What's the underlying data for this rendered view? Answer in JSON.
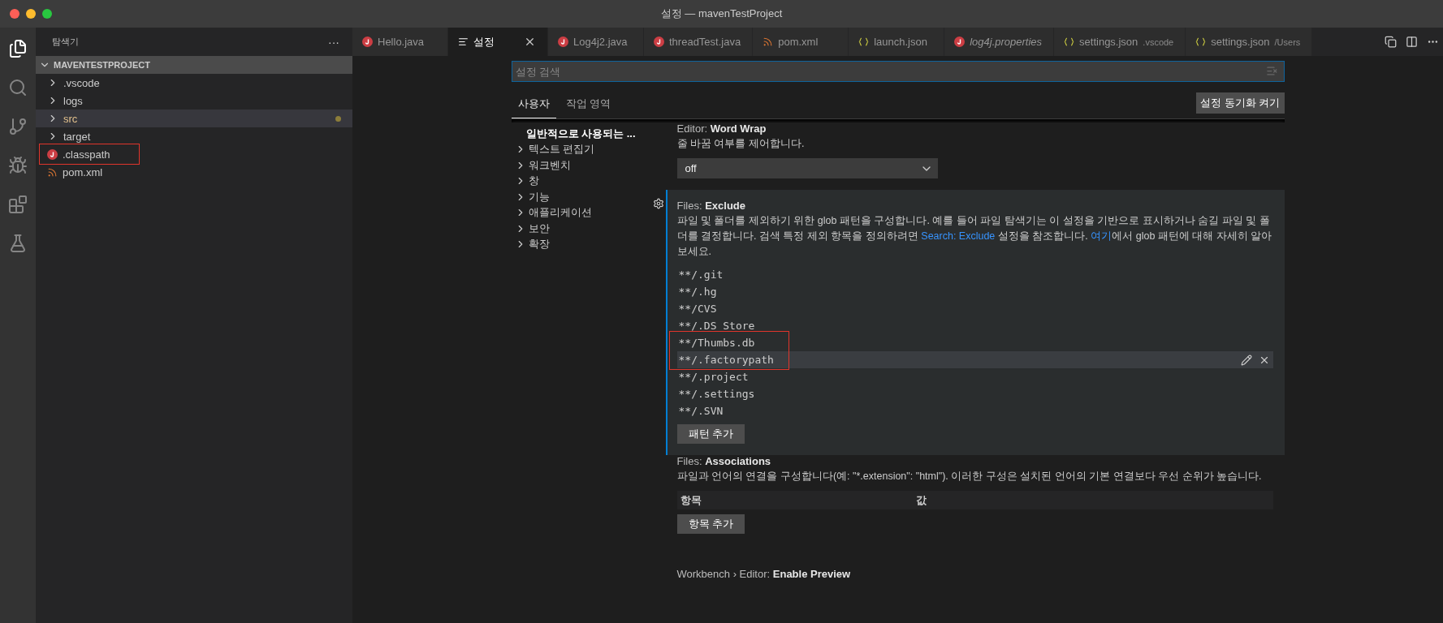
{
  "window": {
    "title": "설정 — mavenTestProject"
  },
  "sidebar": {
    "title": "탐색기",
    "more": "···",
    "section": "MAVENTESTPROJECT",
    "items": [
      {
        "label": ".vscode",
        "kind": "folder",
        "selected": false,
        "modified": false,
        "marked": false
      },
      {
        "label": "logs",
        "kind": "folder",
        "selected": false,
        "modified": false,
        "marked": false
      },
      {
        "label": "src",
        "kind": "folder",
        "selected": true,
        "modified": true,
        "marked": false
      },
      {
        "label": "target",
        "kind": "folder",
        "selected": false,
        "modified": false,
        "marked": false
      },
      {
        "label": ".classpath",
        "kind": "java",
        "selected": false,
        "modified": false,
        "marked": true
      },
      {
        "label": "pom.xml",
        "kind": "xml",
        "selected": false,
        "modified": false,
        "marked": false
      }
    ]
  },
  "tabs": [
    {
      "label": "Hello.java",
      "kind": "java",
      "selected": false,
      "preview": false
    },
    {
      "label": "설정",
      "kind": "settings",
      "selected": true,
      "preview": false
    },
    {
      "label": "Log4j2.java",
      "kind": "java",
      "selected": false,
      "preview": false
    },
    {
      "label": "threadTest.java",
      "kind": "java",
      "selected": false,
      "preview": false
    },
    {
      "label": "pom.xml",
      "kind": "xml",
      "selected": false,
      "preview": false
    },
    {
      "label": "launch.json",
      "kind": "json",
      "selected": false,
      "preview": false
    },
    {
      "label": "log4j.properties",
      "kind": "java",
      "selected": false,
      "preview": true
    },
    {
      "label": "settings.json",
      "description": ".vscode",
      "kind": "json",
      "selected": false,
      "preview": false
    },
    {
      "label": "settings.json",
      "description": "/Users",
      "kind": "json",
      "selected": false,
      "preview": false
    }
  ],
  "settings": {
    "search": {
      "placeholder": "설정 검색"
    },
    "scopes": [
      {
        "label": "사용자",
        "selected": true
      },
      {
        "label": "작업 영역",
        "selected": false
      }
    ],
    "sync_button": "설정 동기화 켜기",
    "toc": [
      {
        "label": "일반적으로 사용되는 ...",
        "selected": true,
        "expandable": false
      },
      {
        "label": "텍스트 편집기",
        "selected": false,
        "expandable": true
      },
      {
        "label": "워크벤치",
        "selected": false,
        "expandable": true
      },
      {
        "label": "창",
        "selected": false,
        "expandable": true
      },
      {
        "label": "기능",
        "selected": false,
        "expandable": true
      },
      {
        "label": "애플리케이션",
        "selected": false,
        "expandable": true
      },
      {
        "label": "보안",
        "selected": false,
        "expandable": true
      },
      {
        "label": "확장",
        "selected": false,
        "expandable": true
      }
    ],
    "items": [
      {
        "kind": "select",
        "category": "Editor: ",
        "title": "Word Wrap",
        "focused": false,
        "description": [
          {
            "text": "줄 바꿈 여부를 제어합니다."
          }
        ],
        "value": "off"
      },
      {
        "kind": "list",
        "category": "Files: ",
        "title": "Exclude",
        "focused": true,
        "description": [
          {
            "text": "파일 및 폴더를 제외하기 위한 glob 패턴을 구성합니다. 예를 들어 파일 탐색기는 이 설정을 기반으로 표시하거나 숨길 파일 및 폴더를 결정합니다. 검색 특정 제외 항목을 정의하려면 "
          },
          {
            "link": "Search: Exclude"
          },
          {
            "text": " 설정을 참조합니다. "
          },
          {
            "link": "여기"
          },
          {
            "text": "에서 glob 패턴에 대해 자세히 알아보세요."
          }
        ],
        "patterns": [
          {
            "text": "**/.git",
            "hovered": false,
            "marked": false
          },
          {
            "text": "**/.hg",
            "hovered": false,
            "marked": false
          },
          {
            "text": "**/CVS",
            "hovered": false,
            "marked": false
          },
          {
            "text": "**/.DS_Store",
            "hovered": false,
            "marked": false
          },
          {
            "text": "**/Thumbs.db",
            "hovered": false,
            "marked": true
          },
          {
            "text": "**/.factorypath",
            "hovered": true,
            "marked": true
          },
          {
            "text": "**/.project",
            "hovered": false,
            "marked": false
          },
          {
            "text": "**/.settings",
            "hovered": false,
            "marked": false
          },
          {
            "text": "**/.SVN",
            "hovered": false,
            "marked": false
          }
        ],
        "button": "패턴 추가"
      },
      {
        "kind": "table",
        "category": "Files: ",
        "title": "Associations",
        "focused": false,
        "description": [
          {
            "text": "파일과 언어의 연결을 구성합니다(예: \"*.extension\": \"html\"). 이러한 구성은 설치된 언어의 기본 연결보다 우선 순위가 높습니다."
          }
        ],
        "columns": [
          "항목",
          "값"
        ],
        "button": "항목 추가"
      },
      {
        "kind": "heading",
        "category": "Workbench › Editor: ",
        "title": "Enable Preview",
        "focused": false
      }
    ]
  }
}
